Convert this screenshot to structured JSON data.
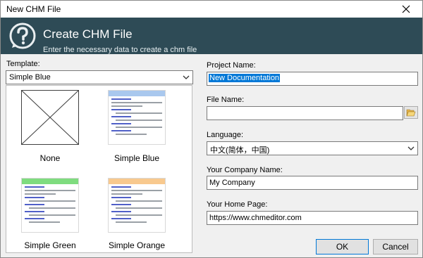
{
  "window": {
    "title": "New CHM File"
  },
  "header": {
    "title": "Create CHM File",
    "subtitle": "Enter the necessary data to create a chm file"
  },
  "template": {
    "label": "Template:",
    "selected": "Simple Blue",
    "options": [
      {
        "label": "None"
      },
      {
        "label": "Simple Blue"
      },
      {
        "label": "Simple Green"
      },
      {
        "label": "Simple Orange"
      }
    ]
  },
  "project": {
    "label": "Project Name:",
    "value": "New Documentation"
  },
  "file": {
    "label": "File Name:",
    "value": ""
  },
  "language": {
    "label": "Language:",
    "value": "中文(简体，中国)"
  },
  "company": {
    "label": "Your Company Name:",
    "value": "My Company"
  },
  "homepage": {
    "label": "Your Home Page:",
    "value": "https://www.chmeditor.com"
  },
  "buttons": {
    "ok": "OK",
    "cancel": "Cancel"
  },
  "colors": {
    "header_bg": "#2e4b56",
    "blue_bar": "#a9c8ee",
    "green_bar": "#7fdc7f",
    "orange_bar": "#f8c98e",
    "selection": "#0078d7"
  },
  "icons": [
    "close-icon",
    "chm-logo-icon",
    "chevron-down-icon",
    "folder-open-icon"
  ]
}
